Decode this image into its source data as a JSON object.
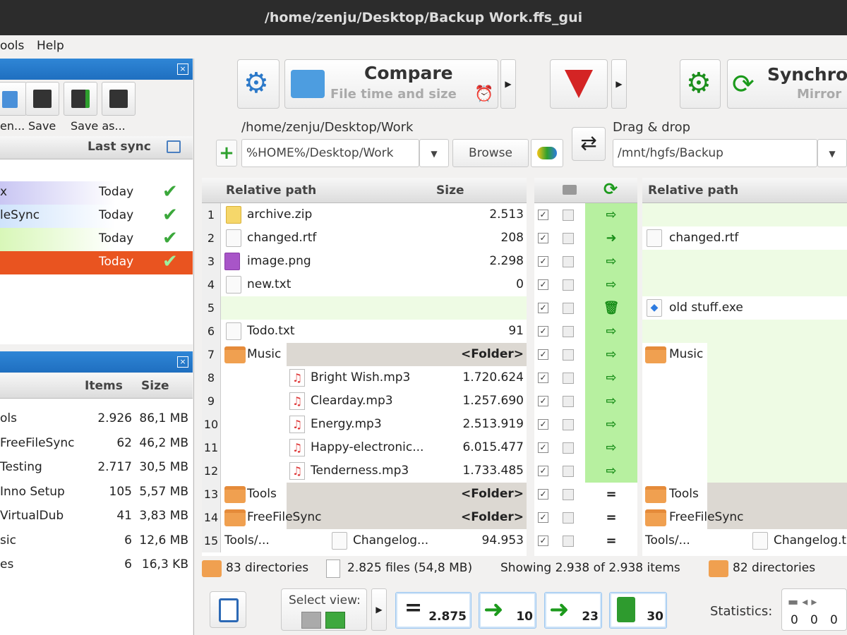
{
  "window": {
    "title": "/home/zenju/Desktop/Backup Work.ffs_gui"
  },
  "menu": [
    "ools",
    "Help"
  ],
  "config_panel": {
    "tools": [
      {
        "label": "en...",
        "icon": "open-icon"
      },
      {
        "label": "Save",
        "icon": "save-icon"
      },
      {
        "label": "Save as...",
        "icon": "save-as-icon"
      },
      {
        "label": "",
        "icon": "save-batch-icon"
      }
    ],
    "header_last_sync": "Last sync",
    "rows": [
      {
        "name": "x",
        "last_sync": "Today"
      },
      {
        "name": "leSync",
        "last_sync": "Today"
      },
      {
        "name": "",
        "last_sync": "Today"
      },
      {
        "name": "",
        "last_sync": "Today"
      }
    ]
  },
  "overview_panel": {
    "header_items": "Items",
    "header_size": "Size",
    "rows": [
      {
        "name": "ols",
        "items": "2.926",
        "size": "86,1 MB"
      },
      {
        "name": "FreeFileSync",
        "items": "62",
        "size": "46,2 MB"
      },
      {
        "name": "Testing",
        "items": "2.717",
        "size": "30,5 MB"
      },
      {
        "name": "Inno Setup",
        "items": "105",
        "size": "5,57 MB"
      },
      {
        "name": "VirtualDub",
        "items": "41",
        "size": "3,83 MB"
      },
      {
        "name": "sic",
        "items": "6",
        "size": "12,6 MB"
      },
      {
        "name": "es",
        "items": "6",
        "size": "16,3 KB"
      }
    ]
  },
  "toolbar": {
    "compare_label": "Compare",
    "compare_sub": "File time and size",
    "sync_label": "Synchro",
    "sync_sub": "Mirror"
  },
  "paths": {
    "left_caption": "/home/zenju/Desktop/Work",
    "left_input": "%HOME%/Desktop/Work",
    "browse": "Browse",
    "right_caption": "Drag & drop",
    "right_input": "/mnt/hgfs/Backup"
  },
  "grid": {
    "header_path": "Relative path",
    "header_size": "Size",
    "rows": [
      {
        "n": "1",
        "name": "archive.zip",
        "size": "2.513",
        "kind": "file",
        "act": "⇨",
        "right": ""
      },
      {
        "n": "2",
        "name": "changed.rtf",
        "size": "208",
        "kind": "file",
        "act": "➜",
        "right": "changed.rtf"
      },
      {
        "n": "3",
        "name": "image.png",
        "size": "2.298",
        "kind": "image",
        "act": "⇨",
        "right": ""
      },
      {
        "n": "4",
        "name": "new.txt",
        "size": "0",
        "kind": "file",
        "act": "⇨",
        "right": ""
      },
      {
        "n": "5",
        "name": "",
        "size": "",
        "kind": "empty",
        "act": "🗑",
        "right": "old stuff.exe"
      },
      {
        "n": "6",
        "name": "Todo.txt",
        "size": "91",
        "kind": "file",
        "act": "⇨",
        "right": ""
      },
      {
        "n": "7",
        "name": "Music",
        "size": "<Folder>",
        "kind": "folder",
        "act": "⇨",
        "right": "Music"
      },
      {
        "n": "8",
        "name": "Bright Wish.mp3",
        "size": "1.720.624",
        "kind": "mp3",
        "act": "⇨",
        "right": ""
      },
      {
        "n": "9",
        "name": "Clearday.mp3",
        "size": "1.257.690",
        "kind": "mp3",
        "act": "⇨",
        "right": ""
      },
      {
        "n": "10",
        "name": "Energy.mp3",
        "size": "2.513.919",
        "kind": "mp3",
        "act": "⇨",
        "right": ""
      },
      {
        "n": "11",
        "name": "Happy-electronic...",
        "size": "6.015.477",
        "kind": "mp3",
        "act": "⇨",
        "right": ""
      },
      {
        "n": "12",
        "name": "Tenderness.mp3",
        "size": "1.733.485",
        "kind": "mp3",
        "act": "⇨",
        "right": ""
      },
      {
        "n": "13",
        "name": "Tools",
        "size": "<Folder>",
        "kind": "folder",
        "act": "=",
        "right": "Tools"
      },
      {
        "n": "14",
        "name": "FreeFileSync",
        "size": "<Folder>",
        "kind": "folder",
        "act": "=",
        "right": "FreeFileSync"
      },
      {
        "n": "15",
        "name": "Changelog...",
        "prefix": "Tools/...",
        "size": "94.953",
        "kind": "file",
        "act": "=",
        "right": "Changelog.t",
        "right_prefix": "Tools/..."
      }
    ]
  },
  "status": {
    "left_dirs": "83 directories",
    "left_files": "2.825 files (54,8 MB)",
    "showing": "Showing 2.938 of 2.938 items",
    "right_dirs": "82 directories"
  },
  "bottom": {
    "select_view": "Select view:",
    "equal_count": "2.875",
    "create_count": "10",
    "update_count": "23",
    "delete_count": "30",
    "statistics": "Statistics:",
    "stat_values": [
      "0",
      "0",
      "0"
    ]
  },
  "colors": {
    "accent": "#2f86d6",
    "selected": "#e95420",
    "sync_green": "#1a8f1a"
  }
}
